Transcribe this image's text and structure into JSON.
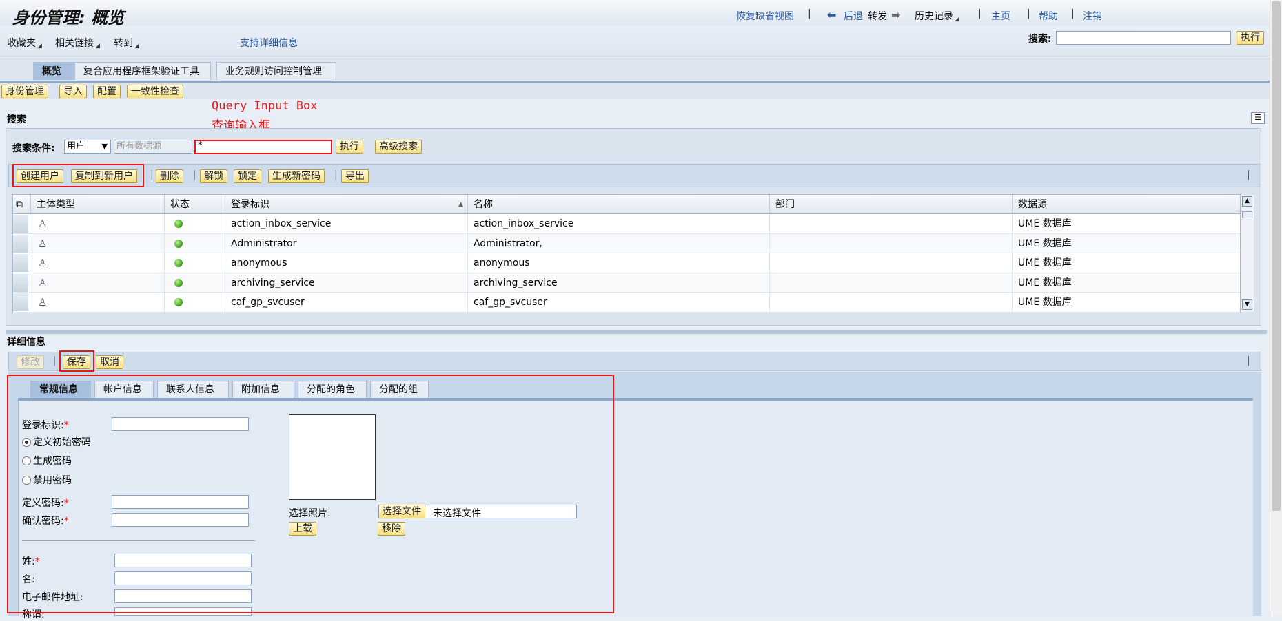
{
  "header": {
    "title": "身份管理: 概览",
    "restore_view": "恢复缺省视图",
    "back": "后退",
    "forward": "转发",
    "history": "历史记录",
    "home": "主页",
    "help": "帮助",
    "logout": "注销",
    "search_label": "搜索:",
    "search_value": "",
    "search_button": "执行"
  },
  "menubar": {
    "favorites": "收藏夹",
    "related_links": "相关链接",
    "goto": "转到",
    "support_info": "支持详细信息"
  },
  "main_tabs": [
    {
      "label": "概览",
      "active": true
    },
    {
      "label": "复合应用程序框架验证工具",
      "active": false
    },
    {
      "label": "业务规则访问控制管理",
      "active": false
    }
  ],
  "sub_buttons": [
    "身份管理",
    "导入",
    "配置",
    "一致性检查"
  ],
  "annotation": {
    "line1": "Query Input Box",
    "line2": "查询输入框"
  },
  "search_section": {
    "title": "搜索",
    "criteria_label": "搜索条件:",
    "criteria_value": "用户",
    "datasource_placeholder": "所有数据源",
    "query_value": "*",
    "execute": "执行",
    "advanced": "高级搜索"
  },
  "table_toolbar": {
    "create_user": "创建用户",
    "copy_user": "复制到新用户",
    "delete": "删除",
    "unlock": "解锁",
    "lock": "锁定",
    "gen_password": "生成新密码",
    "export": "导出"
  },
  "table": {
    "columns": [
      "主体类型",
      "状态",
      "登录标识",
      "名称",
      "部门",
      "数据源"
    ],
    "rows": [
      {
        "login": "action_inbox_service",
        "name": "action_inbox_service",
        "dept": "",
        "source": "UME 数据库"
      },
      {
        "login": "Administrator",
        "name": "Administrator,",
        "dept": "",
        "source": "UME 数据库"
      },
      {
        "login": "anonymous",
        "name": "anonymous",
        "dept": "",
        "source": "UME 数据库"
      },
      {
        "login": "archiving_service",
        "name": "archiving_service",
        "dept": "",
        "source": "UME 数据库"
      },
      {
        "login": "caf_gp_svcuser",
        "name": "caf_gp_svcuser",
        "dept": "",
        "source": "UME 数据库"
      }
    ],
    "status_color": "#3a9a1a"
  },
  "detail": {
    "title": "详细信息",
    "modify": "修改",
    "save": "保存",
    "cancel": "取消",
    "tabs": [
      {
        "label": "常规信息",
        "active": true
      },
      {
        "label": "帐户信息",
        "active": false
      },
      {
        "label": "联系人信息",
        "active": false
      },
      {
        "label": "附加信息",
        "active": false
      },
      {
        "label": "分配的角色",
        "active": false
      },
      {
        "label": "分配的组",
        "active": false
      }
    ],
    "form": {
      "login_label": "登录标识:",
      "radio_define": "定义初始密码",
      "radio_generate": "生成密码",
      "radio_disable": "禁用密码",
      "define_pw_label": "定义密码:",
      "confirm_pw_label": "确认密码:",
      "lastname_label": "姓:",
      "firstname_label": "名:",
      "email_label": "电子邮件地址:",
      "salutation_label": "称谓:",
      "required_mark": "*",
      "photo_label": "选择照片:",
      "choose_file": "选择文件",
      "no_file": "未选择文件",
      "upload": "上载",
      "remove": "移除"
    }
  },
  "colors": {
    "accent_red": "#e81818",
    "link_blue": "#2a5aa3",
    "button_yellow": "#f6df83"
  }
}
